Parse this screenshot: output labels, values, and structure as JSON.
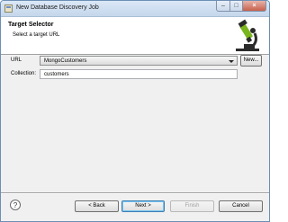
{
  "window": {
    "title": "New Database Discovery Job",
    "controls": {
      "minimize": "–",
      "maximize": "□",
      "close": "×"
    }
  },
  "header": {
    "title": "Target Selector",
    "description": "Select a target URL",
    "banner_icon": "microscope-icon"
  },
  "form": {
    "url_label": "URL",
    "url_value": "MongoCustomers",
    "new_button": "New...",
    "collection_label": "Collection:",
    "collection_value": "customers"
  },
  "footer": {
    "help_label": "?",
    "back": "< Back",
    "next": "Next >",
    "finish": "Finish",
    "cancel": "Cancel"
  },
  "colors": {
    "accent": "#3c7fb1",
    "microscope_green": "#7ab51d",
    "microscope_dark": "#2b2b2b"
  }
}
